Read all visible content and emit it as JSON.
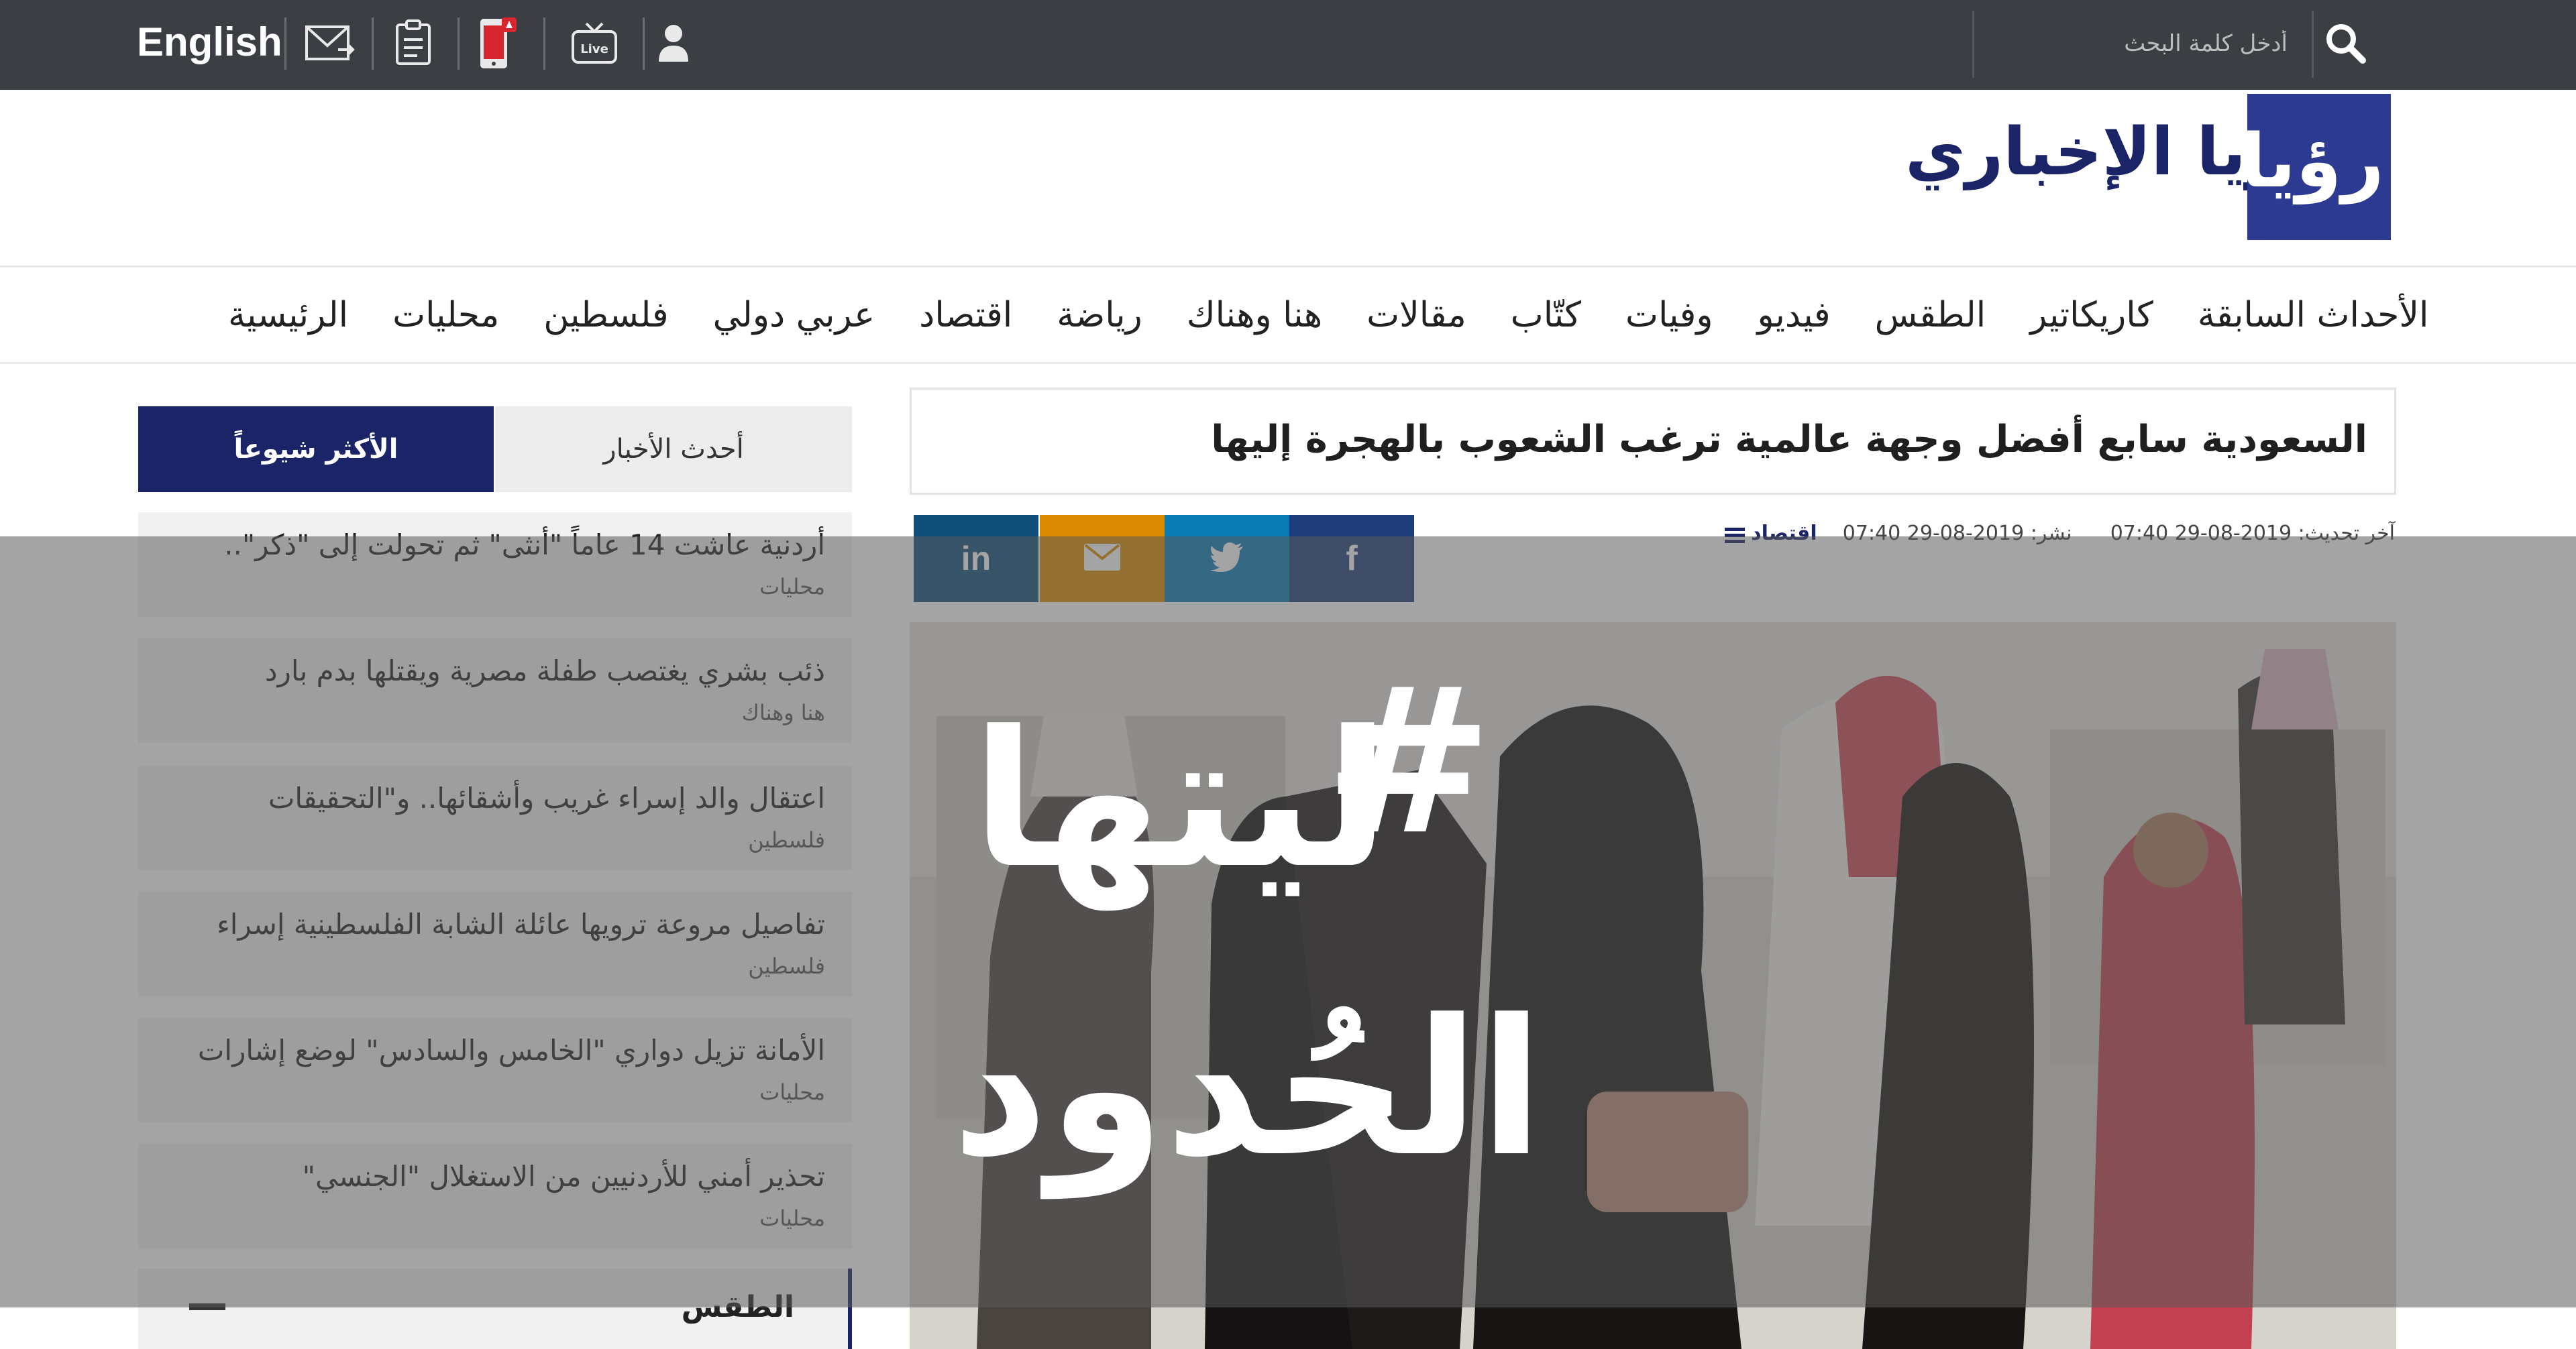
{
  "topbar": {
    "english_label": "English",
    "search_placeholder": "أدخل كلمة البحث",
    "icons": [
      "mail-icon",
      "clipboard-icon",
      "mobile-app-icon",
      "live-tv-icon",
      "user-icon",
      "search-icon"
    ],
    "live_label": "Live"
  },
  "brand": {
    "title": "رؤيا الإخباري",
    "logo_text": "رؤيا"
  },
  "nav": {
    "items": [
      "الرئيسية",
      "محليات",
      "فلسطين",
      "عربي دولي",
      "اقتصاد",
      "رياضة",
      "هنا وهناك",
      "مقالات",
      "كتّاب",
      "وفيات",
      "فيديو",
      "الطقس",
      "كاريكاتير",
      "الأحداث السابقة"
    ]
  },
  "article": {
    "headline": "السعودية سابع أفضل وجهة عالمية ترغب الشعوب بالهجرة إليها",
    "category": "اقتصاد",
    "published": "نشر: 2019-08-29 07:40",
    "updated": "آخر تحديث: 2019-08-29 07:40"
  },
  "share": {
    "icons": [
      "facebook-icon",
      "twitter-icon",
      "email-icon",
      "linkedin-icon"
    ],
    "facebook": "f",
    "linkedin": "in"
  },
  "sidebar": {
    "tab_active": "الأكثر شيوعاً",
    "tab_inactive": "أحدث الأخبار",
    "items": [
      {
        "title": "أردنية عاشت 14 عاماً \"أنثى\" ثم تحولت إلى \"ذكر\"..",
        "category": "محليات"
      },
      {
        "title": "ذئب بشري يغتصب طفلة مصرية ويقتلها بدم بارد",
        "category": "هنا وهناك"
      },
      {
        "title": "اعتقال والد إسراء غريب وأشقائها.. و\"التحقيقات",
        "category": "فلسطين"
      },
      {
        "title": "تفاصيل مروعة ترويها عائلة الشابة الفلسطينية إسراء",
        "category": "فلسطين"
      },
      {
        "title": "الأمانة تزيل دواري \"الخامس والسادس\" لوضع إشارات",
        "category": "محليات"
      },
      {
        "title": "تحذير أمني للأردنيين من الاستغلال \"الجنسي\"",
        "category": "محليات"
      }
    ],
    "weather_title": "الطقس"
  },
  "overlay": {
    "hashtag": "#",
    "line1": "ليتها",
    "line2": "الحُدود"
  },
  "colors": {
    "topbar": "#3b3e43",
    "brand": "#1b2466",
    "facebook": "#1f3d7a",
    "twitter": "#0b7bb6",
    "email": "#d98a00",
    "linkedin": "#0f4f7a"
  }
}
